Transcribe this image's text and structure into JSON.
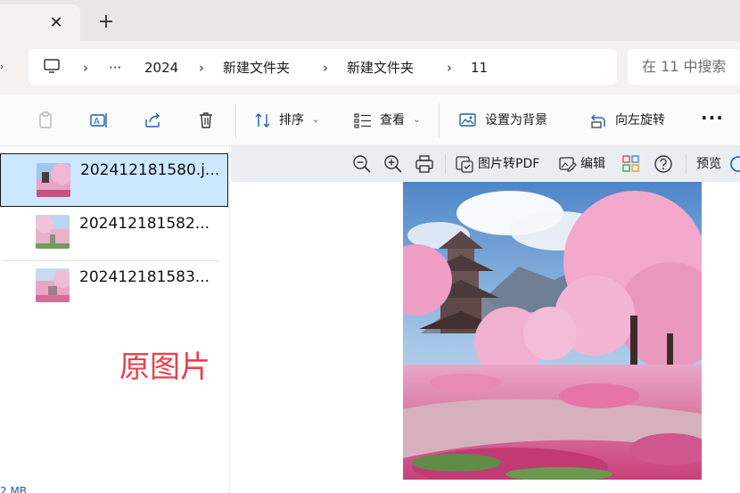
{
  "tabbar": {
    "close_glyph": "✕",
    "new_tab_glyph": "+"
  },
  "address": {
    "icons": [
      "this-pc-icon"
    ],
    "ellipsis": "···",
    "crumbs": [
      "2024",
      "新建文件夹",
      "新建文件夹",
      "11"
    ],
    "separator": "›"
  },
  "search": {
    "placeholder": "在 11 中搜索"
  },
  "toolbar": {
    "sort_label": "排序",
    "view_label": "查看",
    "set_background_label": "设置为背景",
    "rotate_left_label": "向左旋转",
    "more_label": "···",
    "caret": "⌄"
  },
  "files": [
    {
      "name": "202412181580.j...",
      "selected": true
    },
    {
      "name": "202412181582...",
      "selected": false
    },
    {
      "name": "202412181583...",
      "selected": false
    }
  ],
  "annotation": {
    "text": "原图片",
    "color": "#e8404d"
  },
  "status": {
    "size_fragment": "2 MB"
  },
  "preview_toolbar": {
    "to_pdf_label": "图片转PDF",
    "edit_label": "编辑",
    "preview_label": "预览"
  },
  "colors": {
    "selection": "#cce8ff",
    "accent": "#0067c0"
  }
}
